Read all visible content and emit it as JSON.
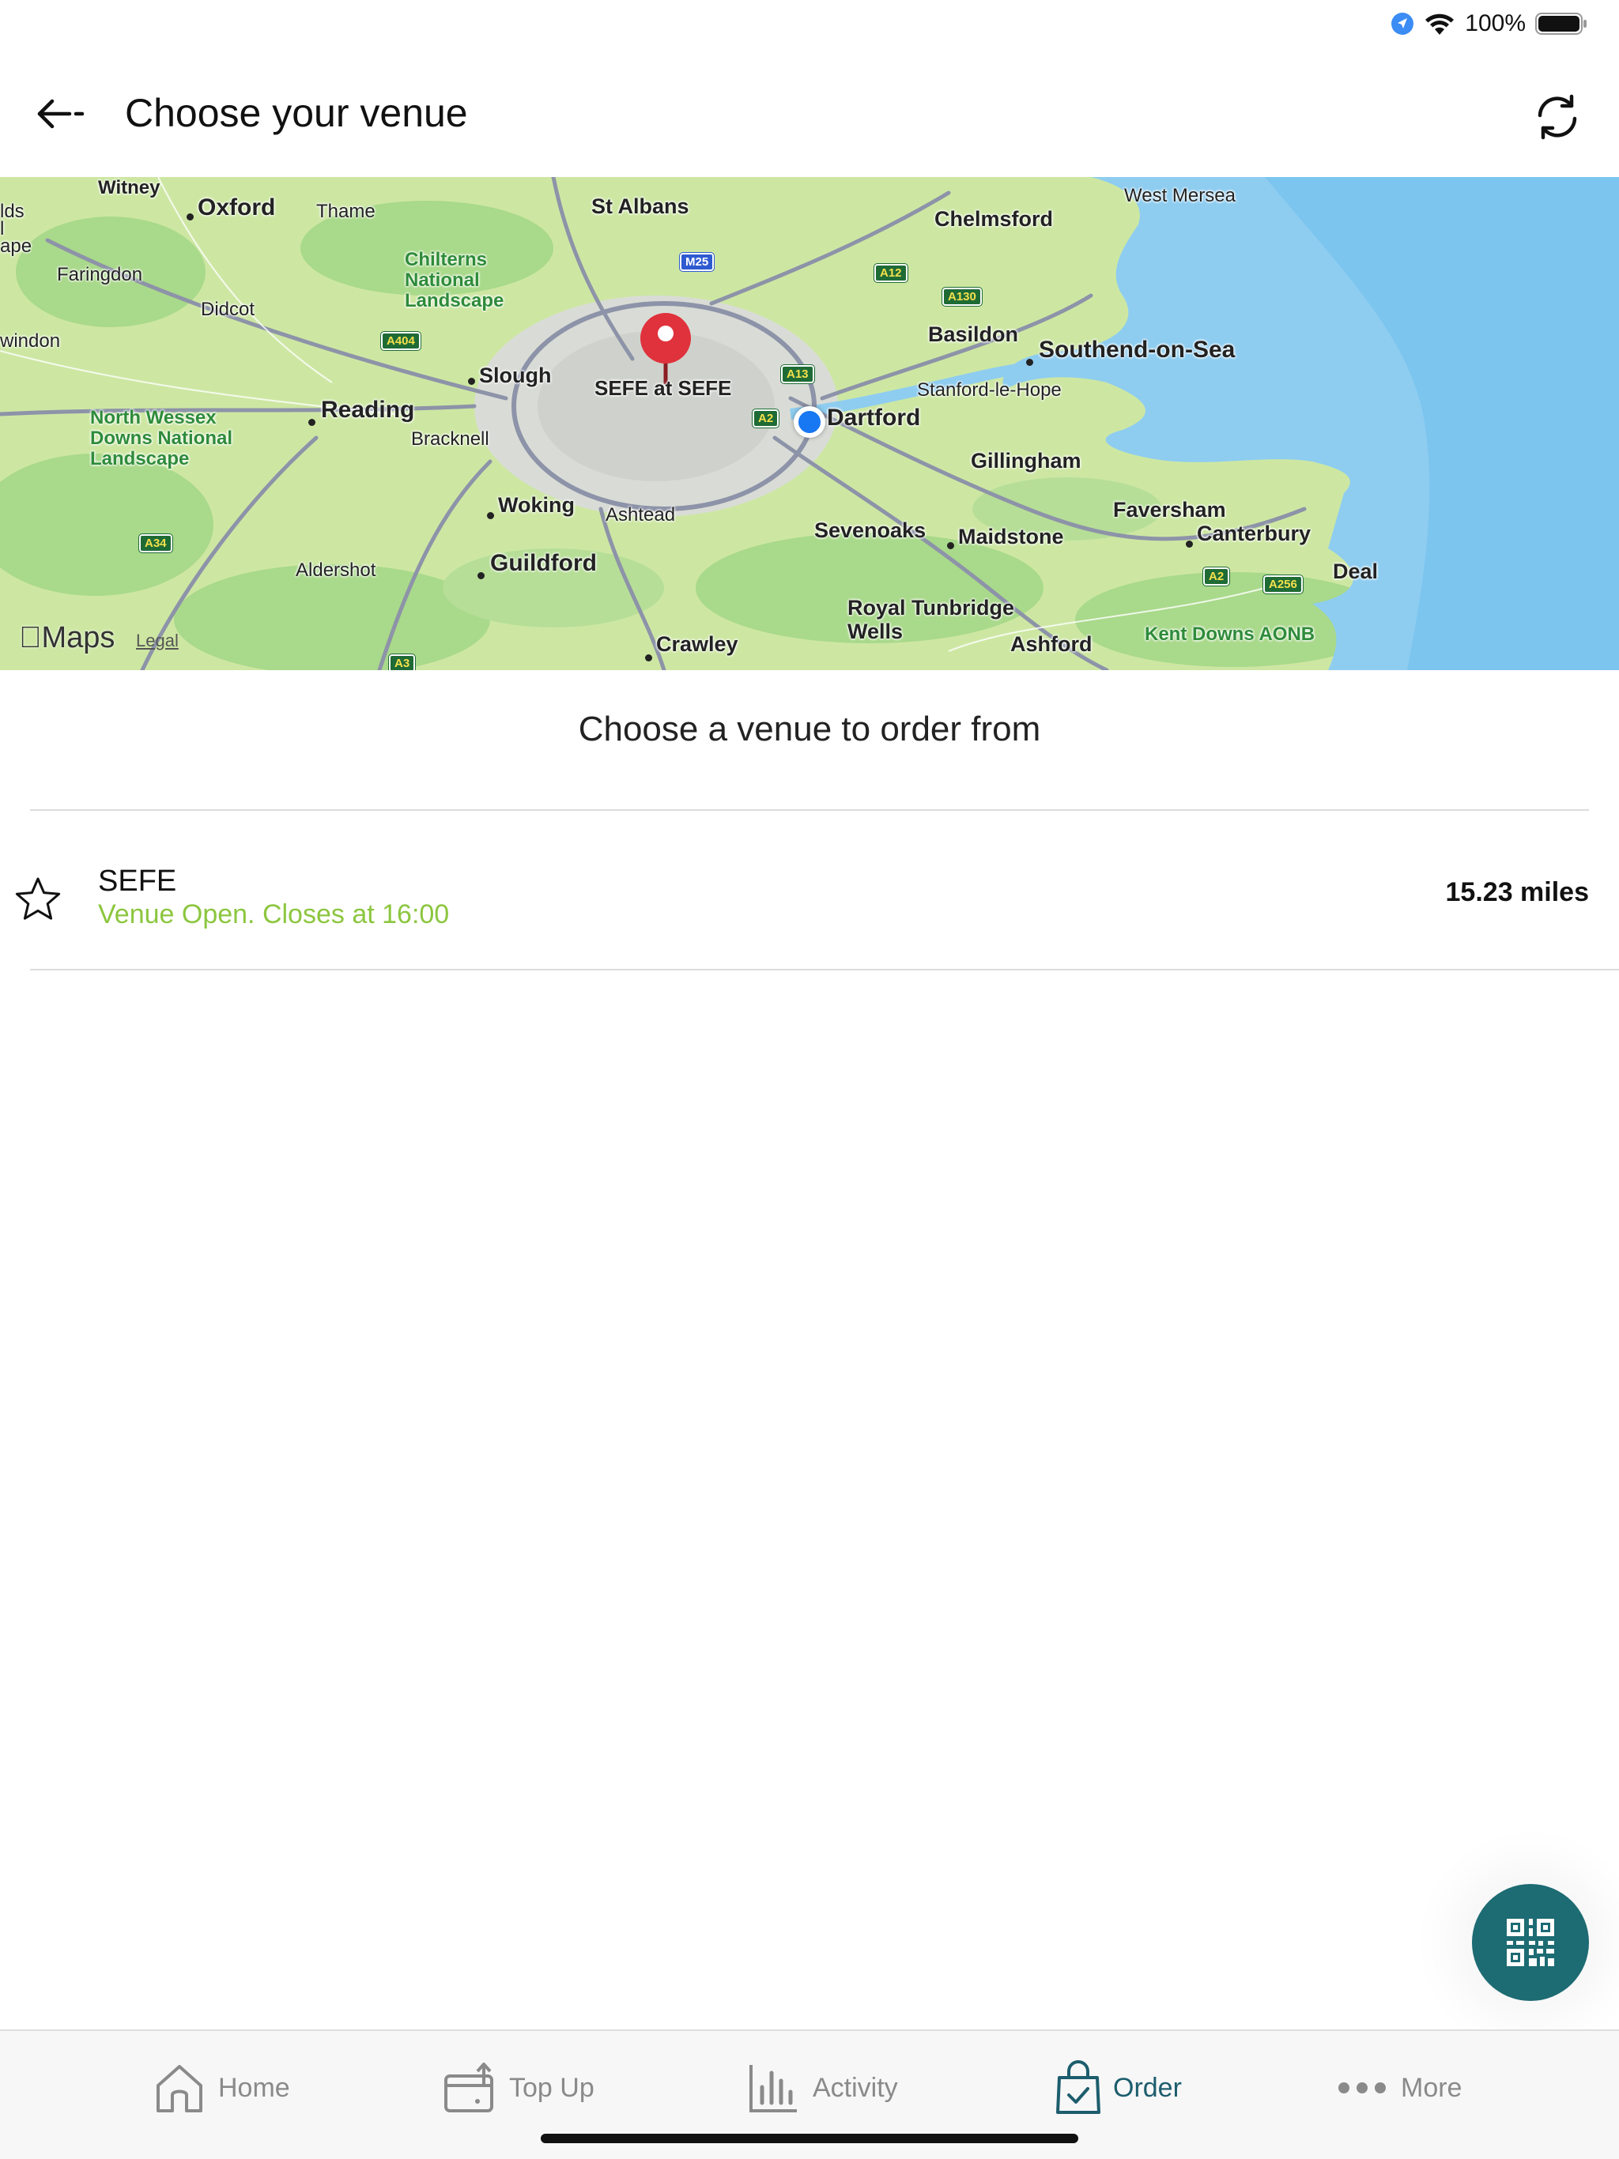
{
  "status_bar": {
    "battery_percent": "100%",
    "icons": [
      "location-icon",
      "wifi-icon",
      "battery-icon"
    ]
  },
  "header": {
    "title": "Choose your venue",
    "back_icon": "back-arrow-icon",
    "refresh_icon": "refresh-icon"
  },
  "map": {
    "venue_pin_label": "SEFE at SEFE",
    "brand": "Maps",
    "legal": "Legal",
    "places": {
      "witney": "Witney",
      "oxford": "Oxford",
      "thame": "Thame",
      "st_albans": "St Albans",
      "chelmsford": "Chelmsford",
      "west_mersea": "West Mersea",
      "faringdon": "Faringdon",
      "didcot": "Didcot",
      "chilterns": "Chilterns National Landscape",
      "swindon": "windon",
      "basildon": "Basildon",
      "southend": "Southend-on-Sea",
      "slough": "Slough",
      "reading": "Reading",
      "stanford": "Stanford-le-Hope",
      "dartford": "Dartford",
      "north_wessex": "North Wessex Downs National Landscape",
      "bracknell": "Bracknell",
      "gillingham": "Gillingham",
      "woking": "Woking",
      "ashtead": "Ashtead",
      "faversham": "Faversham",
      "sevenoaks": "Sevenoaks",
      "maidstone": "Maidstone",
      "canterbury": "Canterbury",
      "aldershot": "Aldershot",
      "guildford": "Guildford",
      "deal": "Deal",
      "royal_tunbridge": "Royal Tunbridge Wells",
      "crawley": "Crawley",
      "ashford": "Ashford",
      "kent_downs": "Kent Downs AONB",
      "edge_lds": "lds",
      "edge_l": "l",
      "edge_ape": "ape"
    },
    "roads": {
      "m25": "M25",
      "a12": "A12",
      "a130": "A130",
      "a404": "A404",
      "a13": "A13",
      "a2": "A2",
      "a34": "A34",
      "a2b": "A2",
      "a256": "A256",
      "a3": "A3"
    }
  },
  "content": {
    "heading": "Choose a venue to order from",
    "venues": [
      {
        "name": "SEFE",
        "status": "Venue Open. Closes at 16:00",
        "distance": "15.23 miles"
      }
    ]
  },
  "fab": {
    "icon": "qr-code-icon"
  },
  "tab_bar": {
    "tabs": [
      {
        "label": "Home",
        "icon": "home-icon"
      },
      {
        "label": "Top Up",
        "icon": "top-up-icon"
      },
      {
        "label": "Activity",
        "icon": "activity-chart-icon"
      },
      {
        "label": "Order",
        "icon": "order-bag-icon",
        "active": true
      },
      {
        "label": "More",
        "icon": "more-dots-icon"
      }
    ]
  },
  "colors": {
    "accent": "#1d6b73",
    "active_tab": "#1d5d6d",
    "open_status": "#8cc63f",
    "pin": "#e0323c",
    "user_location": "#1877f2"
  }
}
